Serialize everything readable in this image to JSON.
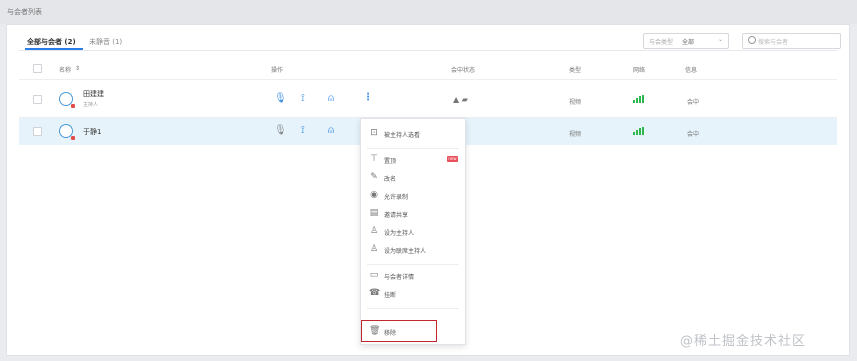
{
  "page": {
    "title": "与会者列表"
  },
  "tabs": [
    {
      "label": "全部与会者 (2)"
    },
    {
      "label": "未静音 (1)"
    }
  ],
  "filter": {
    "label": "与会类型",
    "value": "全部"
  },
  "search": {
    "placeholder": "搜索与会者"
  },
  "columns": {
    "name": "名称",
    "sort": "⇕",
    "actions": "操作",
    "status": "会中状态",
    "type": "类型",
    "signal": "网络",
    "state": "信息"
  },
  "rows": [
    {
      "name": "田建建",
      "sub": "主持人",
      "type": "视频",
      "state": "会中"
    },
    {
      "name": "于静1",
      "type": "视频",
      "state": "会中"
    }
  ],
  "menu": {
    "items": [
      {
        "label": "被主持人选看"
      },
      {
        "label": "置顶",
        "badge": "new"
      },
      {
        "label": "改名"
      },
      {
        "label": "允许录制"
      },
      {
        "label": "邀请共享"
      },
      {
        "label": "设为主持人"
      },
      {
        "label": "设为联席主持人"
      },
      {
        "label": "与会者详情"
      },
      {
        "label": "挂断"
      },
      {
        "label": "移除"
      }
    ]
  },
  "watermark": "@稀土掘金技术社区",
  "colors": {
    "accent": "#2b7de9",
    "highlight": "#c0262d",
    "signal": "#2db84d"
  }
}
